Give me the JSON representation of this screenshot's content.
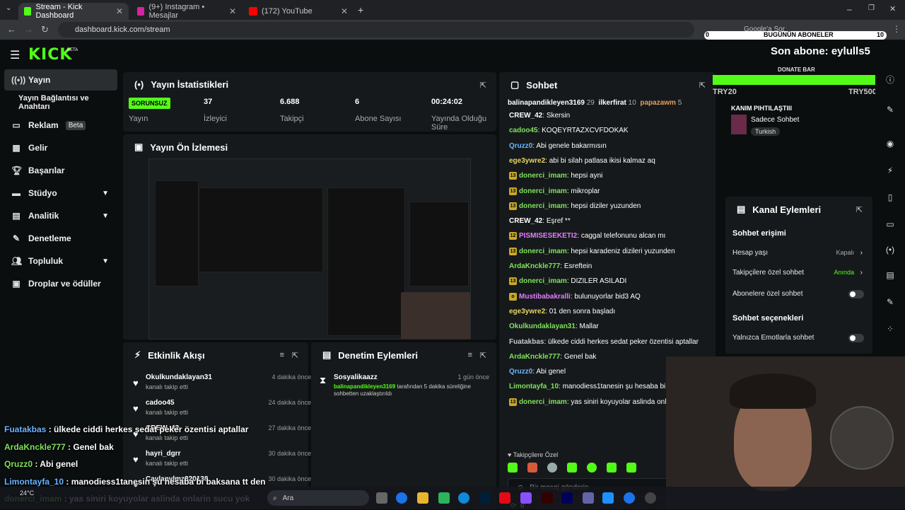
{
  "browser": {
    "tabs": [
      {
        "label": "Stream - Kick Dashboard",
        "active": true
      },
      {
        "label": "(9+) Instagram • Mesajlar",
        "active": false
      },
      {
        "label": "(172) YouTube",
        "active": false
      }
    ],
    "url": "dashboard.kick.com/stream",
    "search_chip": "Google'a Sor"
  },
  "overlay_top": {
    "todays_subs_label": "BUGÜNÜN ABONELER",
    "todays_subs_min": "0",
    "todays_subs_max": "10",
    "last_sub_label": "Son abone:",
    "last_sub_user": "eylulls5",
    "donate_label": "DONATE BAR",
    "donate_min": "TRY20",
    "donate_max": "TRY5000"
  },
  "sidebar": {
    "items": [
      {
        "label": "Yayın",
        "icon": "broadcast-icon"
      },
      {
        "label": "Yayın Bağlantısı ve Anahtarı",
        "icon": ""
      },
      {
        "label": "Reklam",
        "icon": "ad-icon",
        "badge": "Beta"
      },
      {
        "label": "Gelir",
        "icon": "chart-icon"
      },
      {
        "label": "Başarılar",
        "icon": "trophy-icon"
      },
      {
        "label": "Stüdyo",
        "icon": "studio-icon"
      },
      {
        "label": "Analitik",
        "icon": "analytics-icon"
      },
      {
        "label": "Denetleme",
        "icon": "wrench-icon"
      },
      {
        "label": "Topluluk",
        "icon": "community-icon"
      },
      {
        "label": "Droplar ve ödüller",
        "icon": "gift-icon"
      }
    ]
  },
  "stats": {
    "title": "Yayın İstatistikleri",
    "status_badge": "SORUNSUZ",
    "status_label": "Yayın",
    "viewers_value": "37",
    "viewers_label": "İzleyici",
    "followers_value": "6.688",
    "followers_label": "Takipçi",
    "subs_value": "6",
    "subs_label": "Abone Sayısı",
    "uptime_value": "00:24:02",
    "uptime_label": "Yayında Olduğu Süre"
  },
  "preview": {
    "title": "Yayın Ön İzlemesi"
  },
  "activity": {
    "title": "Etkinlik Akışı",
    "items": [
      {
        "name": "Okulkundaklayan31",
        "sub": "kanalı takip etti",
        "time": "4 dakika önce"
      },
      {
        "name": "cadoo45",
        "sub": "kanalı takip etti",
        "time": "24 dakika önce"
      },
      {
        "name": "CREW_42",
        "sub": "kanalı takip etti",
        "time": "27 dakika önce"
      },
      {
        "name": "hayri_dgrr",
        "sub": "kanalı takip etti",
        "time": "30 dakika önce"
      },
      {
        "name": "Caylanvlmz820138",
        "sub": "",
        "time": "30 dakika önce"
      }
    ]
  },
  "moderation": {
    "title": "Denetim Eylemleri",
    "item_name": "Sosyalikaazz",
    "item_time": "1 gün önce",
    "item_actor": "balinapandikleyen3169",
    "item_text": "tarafından 5 dakika süreliğine sohbetten uzaklaştırıldı"
  },
  "chat": {
    "title": "Sohbet",
    "top_users": [
      {
        "name": "balinapandikleyen3169",
        "count": "29"
      },
      {
        "name": "ilkerfirat",
        "count": "10"
      },
      {
        "name": "papazawm",
        "count": "5"
      }
    ],
    "messages": [
      {
        "user": "CREW_42",
        "text": "Skersin",
        "color": "white",
        "sub": ""
      },
      {
        "user": "cadoo45",
        "text": "KOQEYRTAZXCVFDOKAK",
        "color": "green",
        "sub": ""
      },
      {
        "user": "Qruzz0",
        "text": "Abi genele bakarmısın",
        "color": "blue",
        "sub": ""
      },
      {
        "user": "ege3ywre2",
        "text": "abi bi silah patlasa ikisi kalmaz aq",
        "color": "yellow",
        "sub": ""
      },
      {
        "user": "donerci_imam",
        "text": "hepsi ayni",
        "color": "green",
        "sub": "13"
      },
      {
        "user": "donerci_imam",
        "text": "mikroplar",
        "color": "green",
        "sub": "13"
      },
      {
        "user": "donerci_imam",
        "text": "hepsi diziler yuzunden",
        "color": "green",
        "sub": "13"
      },
      {
        "user": "CREW_42",
        "text": "Eşref **",
        "color": "white",
        "sub": ""
      },
      {
        "user": "PISMISESEKETI2",
        "text": "caggal telefonunu alcan mı",
        "color": "pink",
        "sub": "12"
      },
      {
        "user": "donerci_imam",
        "text": "hepsi karadeniz dizileri yuzunden",
        "color": "green",
        "sub": "13"
      },
      {
        "user": "ArdaKnckle777",
        "text": "Esreftein",
        "color": "green",
        "sub": ""
      },
      {
        "user": "donerci_imam",
        "text": "DIZILER ASILADI",
        "color": "green",
        "sub": "13"
      },
      {
        "user": "Mustibabakralli",
        "text": "bulunuyorlar bid3 AQ",
        "color": "pink",
        "sub": "o"
      },
      {
        "user": "ege3ywre2",
        "text": "01 den sonra başladı",
        "color": "yellow",
        "sub": ""
      },
      {
        "user": "Okulkundaklayan31",
        "text": "Mallar",
        "color": "green",
        "sub": ""
      },
      {
        "user": "Fuatakbas",
        "text": "ülkede ciddi herkes sedat peker özentisi aptallar",
        "color": "gray",
        "sub": ""
      },
      {
        "user": "ArdaKnckle777",
        "text": "Genel bak",
        "color": "green",
        "sub": ""
      },
      {
        "user": "Qruzz0",
        "text": "Abi genel",
        "color": "blue",
        "sub": ""
      },
      {
        "user": "Limontayfa_10",
        "text": "manodiess1tanesin şu hesaba bi ba",
        "color": "green",
        "sub": ""
      },
      {
        "user": "donerci_imam",
        "text": "yas siniri koyuyolar aslinda onla",
        "color": "green",
        "sub": "13"
      }
    ],
    "followers_only": "Takipçilere Özel",
    "input_placeholder": "Bir mesaj gönderin",
    "points": "0"
  },
  "stream_info": {
    "title": "KANIM PIHTILAŞTIII",
    "category": "Sadece Sohbet",
    "tag": "Turkish"
  },
  "channel_actions": {
    "title": "Kanal Eylemleri",
    "chat_access": "Sohbet erişimi",
    "account_age_label": "Hesap yaşı",
    "account_age_value": "Kapalı",
    "followers_chat_label": "Takipçilere özel sohbet",
    "followers_chat_value": "Anında",
    "subs_chat_label": "Abonelere özel sohbet",
    "chat_options": "Sohbet seçenekleri",
    "emote_only_label": "Yalnızca Emotlarla sohbet"
  },
  "overlay_chat": [
    {
      "user": "Fuatakbas",
      "text": "ülkede ciddi herkes sedat peker özentisi aptallar",
      "color": "#6ab4ff"
    },
    {
      "user": "ArdaKnckle777",
      "text": "Genel bak",
      "color": "#7ee35b"
    },
    {
      "user": "Qruzz0",
      "text": "Abi genel",
      "color": "#7ee35b"
    },
    {
      "user": "Limontayfa_10",
      "text": "manodiess1tanesin şu hesaba bi baksana tt den",
      "color": "#6ab4ff"
    },
    {
      "user": "donerci_imam",
      "text": "yas siniri koyuyolar aslinda onlarin sucu yok",
      "color": "#7ee35b"
    }
  ],
  "taskbar": {
    "search_placeholder": "Ara",
    "weather": "24°C"
  },
  "colors": {
    "brand": "#53fc18",
    "panel": "#16191b",
    "bg": "#0b0e0f"
  }
}
